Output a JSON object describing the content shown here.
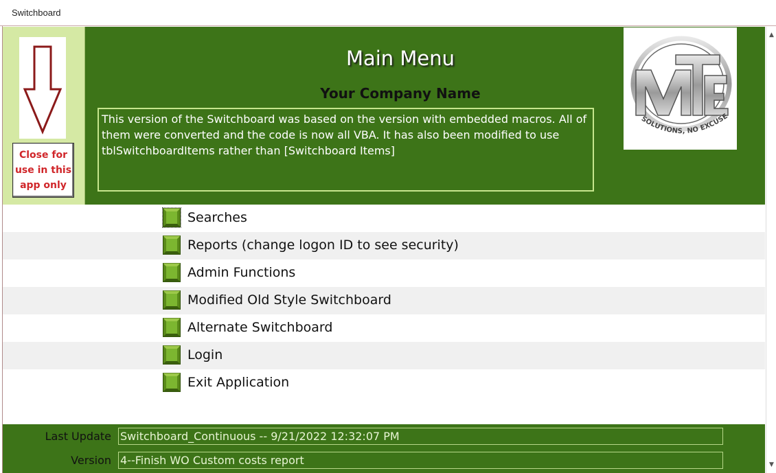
{
  "window": {
    "tab_title": "Switchboard"
  },
  "header": {
    "title": "Main Menu",
    "company": "Your Company Name",
    "description": "This version of the Switchboard was based on the version with embedded macros.  All of them were converted and the code is now all VBA.  It has also been modified to use tblSwitchboardItems rather than [Switchboard Items]",
    "close_button": "Close for use in this app only",
    "logo_text": "SOLUTIONS, NO EXCUSES."
  },
  "menu": {
    "items": [
      {
        "label": "Searches"
      },
      {
        "label": "Reports  (change logon ID to see security)"
      },
      {
        "label": "Admin Functions"
      },
      {
        "label": "Modified Old Style Switchboard"
      },
      {
        "label": "Alternate Switchboard"
      },
      {
        "label": "Login"
      },
      {
        "label": "Exit Application"
      }
    ]
  },
  "footer": {
    "last_update_label": "Last Update",
    "last_update_value": "Switchboard_Continuous -- 9/21/2022 12:32:07 PM",
    "version_label": "Version",
    "version_value": "4--Finish WO Custom costs report"
  },
  "colors": {
    "header_green": "#3d7418",
    "panel_light_green": "#d5e9a4",
    "close_text_red": "#d0262a",
    "arrow_red": "#8b0000"
  },
  "icons": {
    "arrow": "down-arrow-icon",
    "menu_button": "green-square-button-icon",
    "scroll_up": "chevron-up-icon",
    "scroll_down": "chevron-down-icon"
  }
}
